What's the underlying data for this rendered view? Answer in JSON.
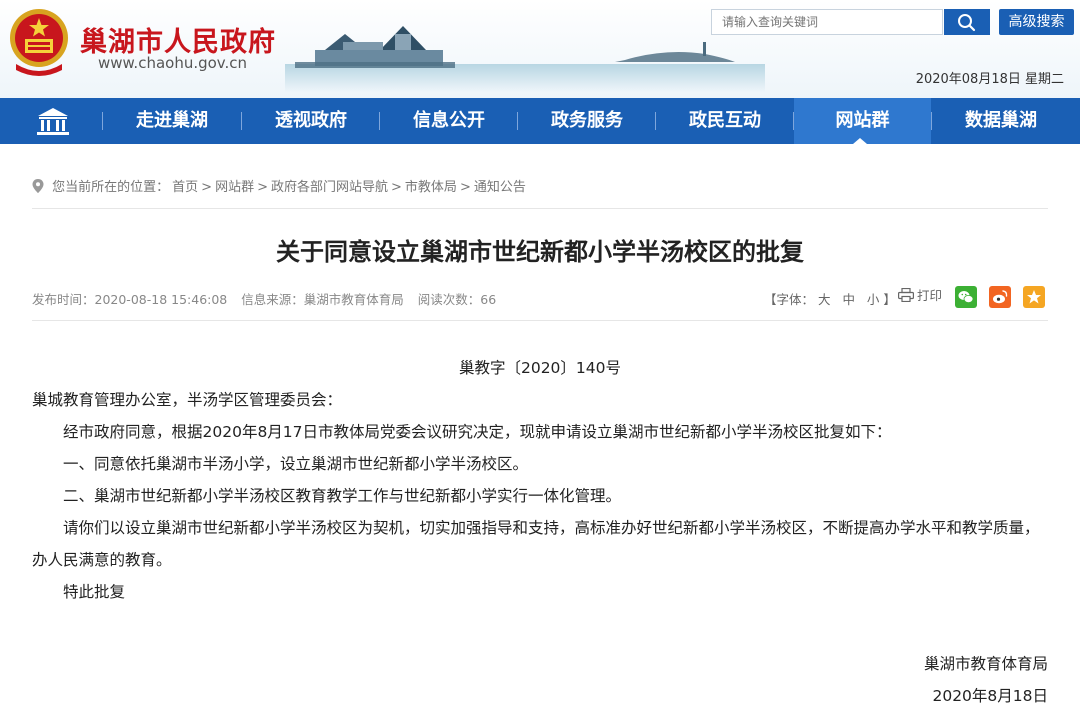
{
  "header": {
    "site_title": "巢湖市人民政府",
    "site_url": "www.chaohu.gov.cn",
    "search_placeholder": "请输入查询关键词",
    "advanced_search": "高级搜索",
    "date": "2020年08月18日 星期二"
  },
  "nav": {
    "items": [
      {
        "label": "走进巢湖"
      },
      {
        "label": "透视政府"
      },
      {
        "label": "信息公开"
      },
      {
        "label": "政务服务"
      },
      {
        "label": "政民互动"
      },
      {
        "label": "网站群"
      },
      {
        "label": "数据巢湖"
      }
    ],
    "active": "网站群"
  },
  "breadcrumb": {
    "prefix": "您当前所在的位置：",
    "items": [
      "首页",
      "网站群",
      "政府各部门网站导航",
      "市教体局",
      "通知公告"
    ],
    "separator": ">"
  },
  "article": {
    "title": "关于同意设立巢湖市世纪新都小学半汤校区的批复",
    "meta": {
      "publish_time": "发布时间：2020-08-18 15:46:08",
      "source": "信息来源：巢湖市教育体育局",
      "views": "阅读次数：66"
    },
    "font_size_label": "【字体：",
    "font_large": "大",
    "font_medium": "中",
    "font_small": "小",
    "font_close": "】",
    "print_label": "打印",
    "doc_number": "巢教字〔2020〕140号",
    "addressee": "巢城教育管理办公室，半汤学区管理委员会：",
    "paragraphs": [
      "经市政府同意，根据2020年8月17日市教体局党委会议研究决定，现就申请设立巢湖市世纪新都小学半汤校区批复如下：",
      "一、同意依托巢湖市半汤小学，设立巢湖市世纪新都小学半汤校区。",
      "二、巢湖市世纪新都小学半汤校区教育教学工作与世纪新都小学实行一体化管理。",
      "请你们以设立巢湖市世纪新都小学半汤校区为契机，切实加强指导和支持，高标准办好世纪新都小学半汤校区，不断提高办学水平和教学质量，办人民满意的教育。",
      "特此批复"
    ],
    "signature": "巢湖市教育体育局",
    "sign_date": "2020年8月18日"
  },
  "colors": {
    "brand_red": "#c8161d",
    "nav_blue": "#1a5fb4",
    "wechat_green": "#3cb034",
    "weibo_orange": "#f26522",
    "favorite_orange": "#f5a623"
  },
  "icons": [
    "emblem-icon",
    "search-icon",
    "home-icon",
    "location-icon",
    "print-icon",
    "wechat-icon",
    "weibo-icon",
    "favorite-icon"
  ]
}
